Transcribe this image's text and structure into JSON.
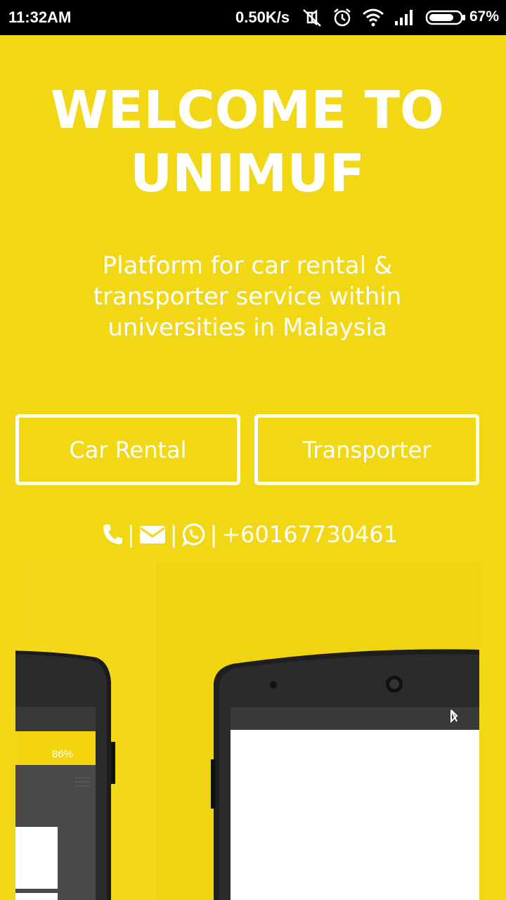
{
  "status_bar": {
    "time": "11:32AM",
    "network_speed": "0.50K/s",
    "battery_percent": "67%",
    "icons": [
      "mute-icon",
      "alarm-icon",
      "wifi-icon",
      "signal-icon",
      "battery-icon"
    ]
  },
  "hero": {
    "title_line1": "WELCOME TO",
    "title_line2": "UNIMUF",
    "subtitle_line1": "Platform for car rental &",
    "subtitle_line2": "transporter service within",
    "subtitle_line3": "universities in Malaysia"
  },
  "buttons": {
    "car_rental": "Car Rental",
    "transporter": "Transporter"
  },
  "contact": {
    "separator": "|",
    "phone_number": "+60167730461",
    "icons": [
      "phone-icon",
      "email-icon",
      "whatsapp-icon"
    ]
  },
  "mockup": {
    "left_phone_battery": "86%"
  },
  "colors": {
    "background": "#f2d715",
    "text": "#ffffff",
    "status_bar": "#000000"
  }
}
